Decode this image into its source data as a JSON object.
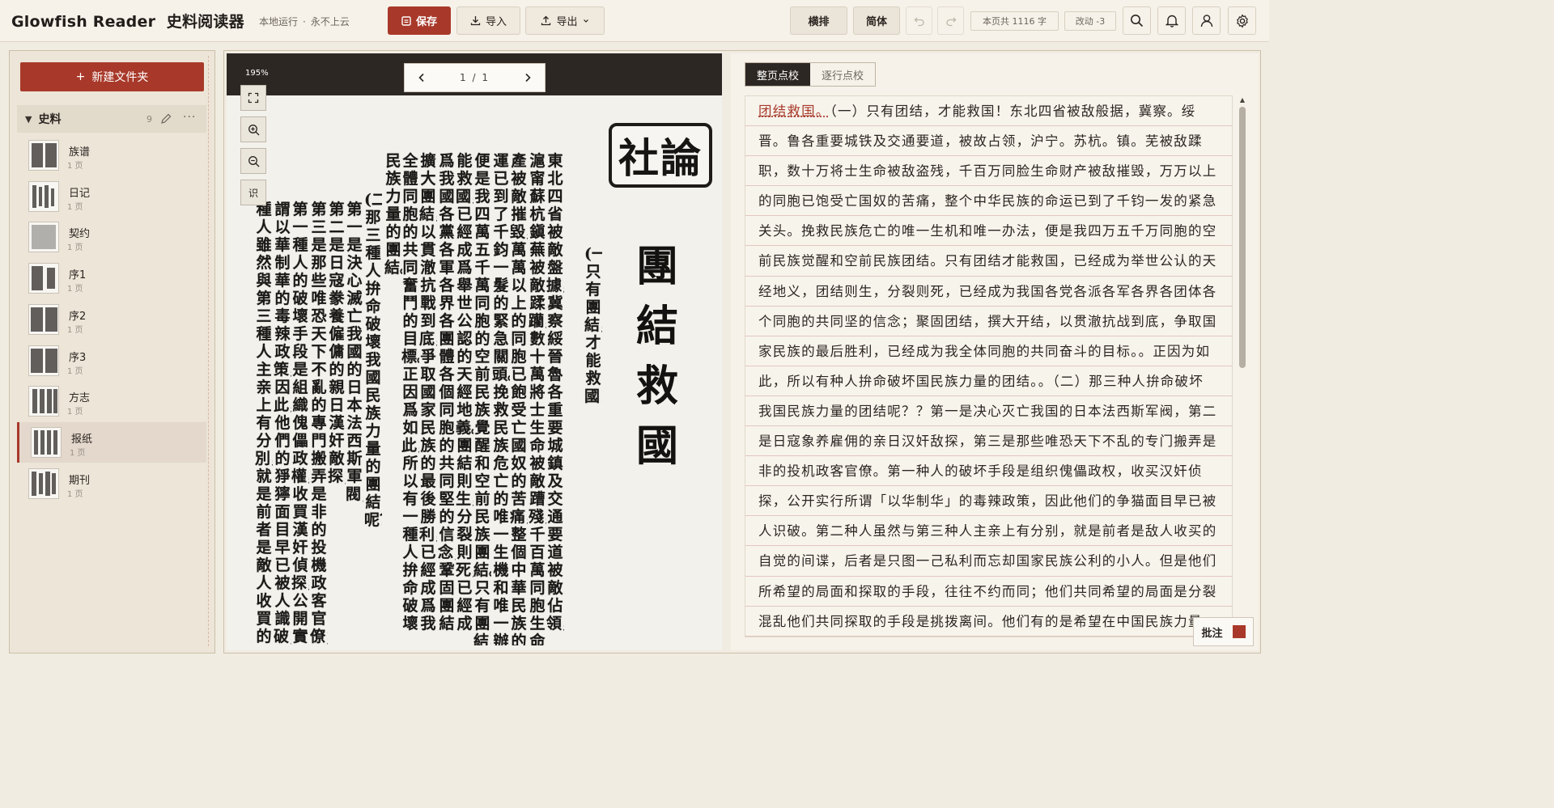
{
  "app": {
    "brand": "Glowfish Reader",
    "name": "史料阅读器",
    "status_local": "本地运行",
    "status_dot": "·",
    "status_cloud": "永不上云"
  },
  "toolbar": {
    "save_label": "保存",
    "import_label": "导入",
    "export_label": "导出",
    "vertical_label": "横排",
    "simplified_label": "简体",
    "char_count": "本页共 1116 字",
    "changes": "改动 -3"
  },
  "icons": {
    "save": "save-icon",
    "import": "download-icon",
    "export": "upload-icon",
    "undo": "undo-icon",
    "redo": "redo-icon",
    "search": "search-icon",
    "bell": "bell-icon",
    "user": "user-icon",
    "settings": "gear-icon"
  },
  "colors": {
    "accent": "#a8392a",
    "dark": "#2d2724",
    "paper": "#f6f2ea"
  },
  "sidebar": {
    "new_folder_label": "新建文件夹",
    "new_folder_plus": "+",
    "folder": {
      "name": "史料",
      "count": "9",
      "more": "···"
    },
    "items": [
      {
        "title": "族谱",
        "pages": "1 页"
      },
      {
        "title": "日记",
        "pages": "1 页"
      },
      {
        "title": "契约",
        "pages": "1 页"
      },
      {
        "title": "序1",
        "pages": "1 页"
      },
      {
        "title": "序2",
        "pages": "1 页"
      },
      {
        "title": "序3",
        "pages": "1 页"
      },
      {
        "title": "方志",
        "pages": "1 页"
      },
      {
        "title": "报纸",
        "pages": "1 页",
        "active": true
      },
      {
        "title": "期刊",
        "pages": "1 页"
      }
    ]
  },
  "viewer": {
    "zoom": "195%",
    "page_indicator": "1 / 1",
    "ocr_label": "识",
    "seal_text": "社論",
    "headline": "團結救國",
    "columns": [
      "(一)只有團結，才能救國！",
      "東北四省被敵盤據，冀察綏晉魯各重要城鎮及交通要道被敵佔領，",
      "滬甯蘇杭鎭蕪被敵蹂躪，數十萬將士生命被敵蹧殘，千百萬同胞生命財",
      "產被敵摧毀，萬萬以上的同胞已飽受亡國奴的苦痛，整個中華民族的命",
      "運已到了千鈞一髮的緊急關頭。挽救民族危亡的唯一生機和唯一辦法，",
      "便是我四萬五千萬同胞的空前民族覺醒和空前民族團結。只有團結，才",
      "能救國，已經成爲舉世公認的天經地義。團結則生，分裂則死，已經成",
      "爲我國各黨各軍各界各團體各個同胞的共同堅的信念；鞏固團結",
      "擴大團結，以貫澈抗戰到底，爭取國家民族的最後勝利，已經成爲我",
      "全體同胞的共同奮鬥的目標。正因爲如此，所以有一種人拚命破壞",
      "民族力量的團結。",
      "(二)那三種人拚命破壞我國民族力量的團結呢？",
      "第一是決心滅亡我國的日本法西斯軍閥；",
      "第二是日寇豢養僱傭的親日漢奸敵探；",
      "第三是那些唯恐天下不亂的專門搬弄是非的投機政客官僚；",
      "第一種人的破壞手段是組織傀儡政權，收買漢奸偵探，公開實行所",
      "謂以華制華的毒辣政策，因此，他們的猙獰面目早已被人識破；第二",
      "種人雖然與第三種人主亲上有分別，就是前者是敵人收買的自覺的間諜"
    ]
  },
  "proof": {
    "tab_page": "整页点校",
    "tab_line": "逐行点校",
    "annotate_label": "批注",
    "first_line_mark": "团结救国。",
    "first_line_rest": "（一）只有团结，才能救国！东北四省被敌般据，冀察。绥",
    "lines": [
      "晋。鲁各重要城铁及交通要道，被故占领，沪宁。苏杭。镇。芜被敌蹂",
      "职，数十万将士生命被敌盗残，千百万同脸生命财产被敌摧毁，万万以上",
      "的同胞已饱受亡国奴的苦痛，整个中华民族的命运已到了千钧一发的紧急",
      "关头。挽救民族危亡的唯一生机和唯一办法，便是我四万五千万同胞的空",
      "前民族觉醒和空前民族团结。只有团结才能救国，已经成为举世公认的天",
      "经地义，团结则生，分裂则死，已经成为我国各党各派各军各界各团体各",
      "个同胞的共同坚的信念；聚固团结，撰大开结，以贯澈抗战到底，争取国",
      "家民族的最后胜利，已经成为我全体同胞的共同奋斗的目标。。正因为如",
      "此，所以有种人拚命破坏国民族力量的团结。。（二）那三种人拚命破坏",
      "我国民族力量的团结呢？？第一是决心灭亡我国的日本法西斯军阀，第二",
      "是日寇象养雇佣的亲日汉奸敌探，第三是那些唯恐天下不乱的专门搬弄是",
      "非的投机政客官僚。第一种人的破坏手段是组织傀儡政权，收买汉奸侦",
      "探，公开实行所谓「以华制华」的毒辣政策，因此他们的争猫面目早已被",
      "人识破。第二种人虽然与第三种人主亲上有分别，就是前者是敌人收买的",
      "自觉的间谍，后者是只图一己私利而忘却国家民族公利的小人。但是他们",
      "所希望的局面和探取的手段，往往不约而同；他们共同希望的局面是分裂",
      "混乱他们共同探取的手段是挑拨离间。他们有的是希望在中国民族力量"
    ]
  }
}
